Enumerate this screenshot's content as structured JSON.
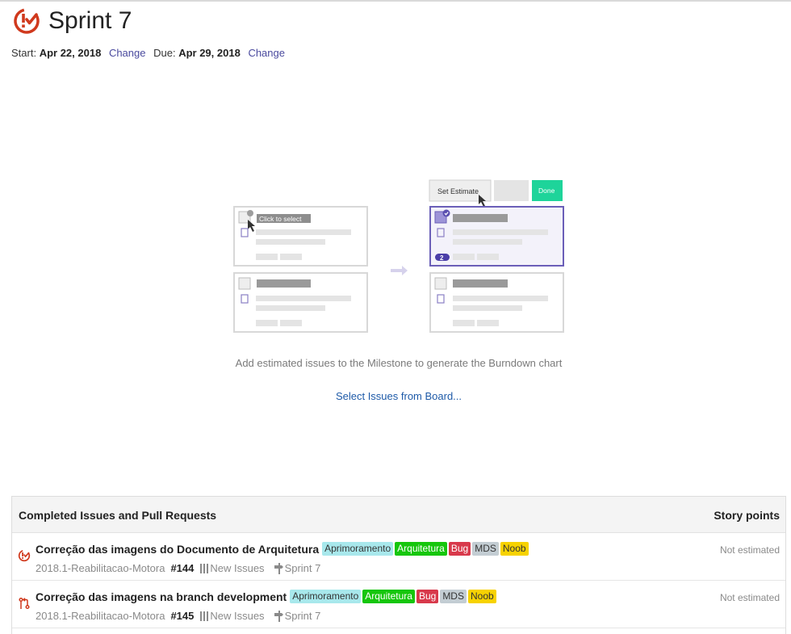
{
  "milestone": {
    "title": "Sprint 7",
    "start_label": "Start:",
    "start_date": "Apr 22, 2018",
    "due_label": "Due:",
    "due_date": "Apr 29, 2018",
    "change_label": "Change",
    "accent_color": "#d0391d"
  },
  "illustration": {
    "click_to_select": "Click to select",
    "set_estimate": "Set Estimate",
    "done": "Done",
    "estimate_badge": "2"
  },
  "empty_state": {
    "message": "Add estimated issues to the Milestone to generate the Burndown chart",
    "select_link": "Select Issues from Board..."
  },
  "panel": {
    "heading": "Completed Issues and Pull Requests",
    "points_heading": "Story points",
    "rows": [
      {
        "type_icon": "issue-closed-icon",
        "title": "Correção das imagens do Documento de Arquitetura",
        "labels": [
          {
            "text": "Aprimoramento",
            "bg": "#a8e8ec",
            "fg": "#333333"
          },
          {
            "text": "Arquitetura",
            "bg": "#16c60c",
            "fg": "#ffffff"
          },
          {
            "text": "Bug",
            "bg": "#d8394b",
            "fg": "#ffffff"
          },
          {
            "text": "MDS",
            "bg": "#c3cdd3",
            "fg": "#333333"
          },
          {
            "text": "Noob",
            "bg": "#f7d200",
            "fg": "#333333"
          }
        ],
        "repo": "2018.1-Reabilitacao-Motora",
        "number": "#144",
        "pipeline": "New Issues",
        "milestone": "Sprint 7",
        "estimate": "Not estimated"
      },
      {
        "type_icon": "pull-request-icon",
        "title": "Correção das imagens na branch development",
        "labels": [
          {
            "text": "Aprimoramento",
            "bg": "#a8e8ec",
            "fg": "#333333"
          },
          {
            "text": "Arquitetura",
            "bg": "#16c60c",
            "fg": "#ffffff"
          },
          {
            "text": "Bug",
            "bg": "#d8394b",
            "fg": "#ffffff"
          },
          {
            "text": "MDS",
            "bg": "#c3cdd3",
            "fg": "#333333"
          },
          {
            "text": "Noob",
            "bg": "#f7d200",
            "fg": "#333333"
          }
        ],
        "repo": "2018.1-Reabilitacao-Motora",
        "number": "#145",
        "pipeline": "New Issues",
        "milestone": "Sprint 7",
        "estimate": "Not estimated"
      }
    ]
  }
}
